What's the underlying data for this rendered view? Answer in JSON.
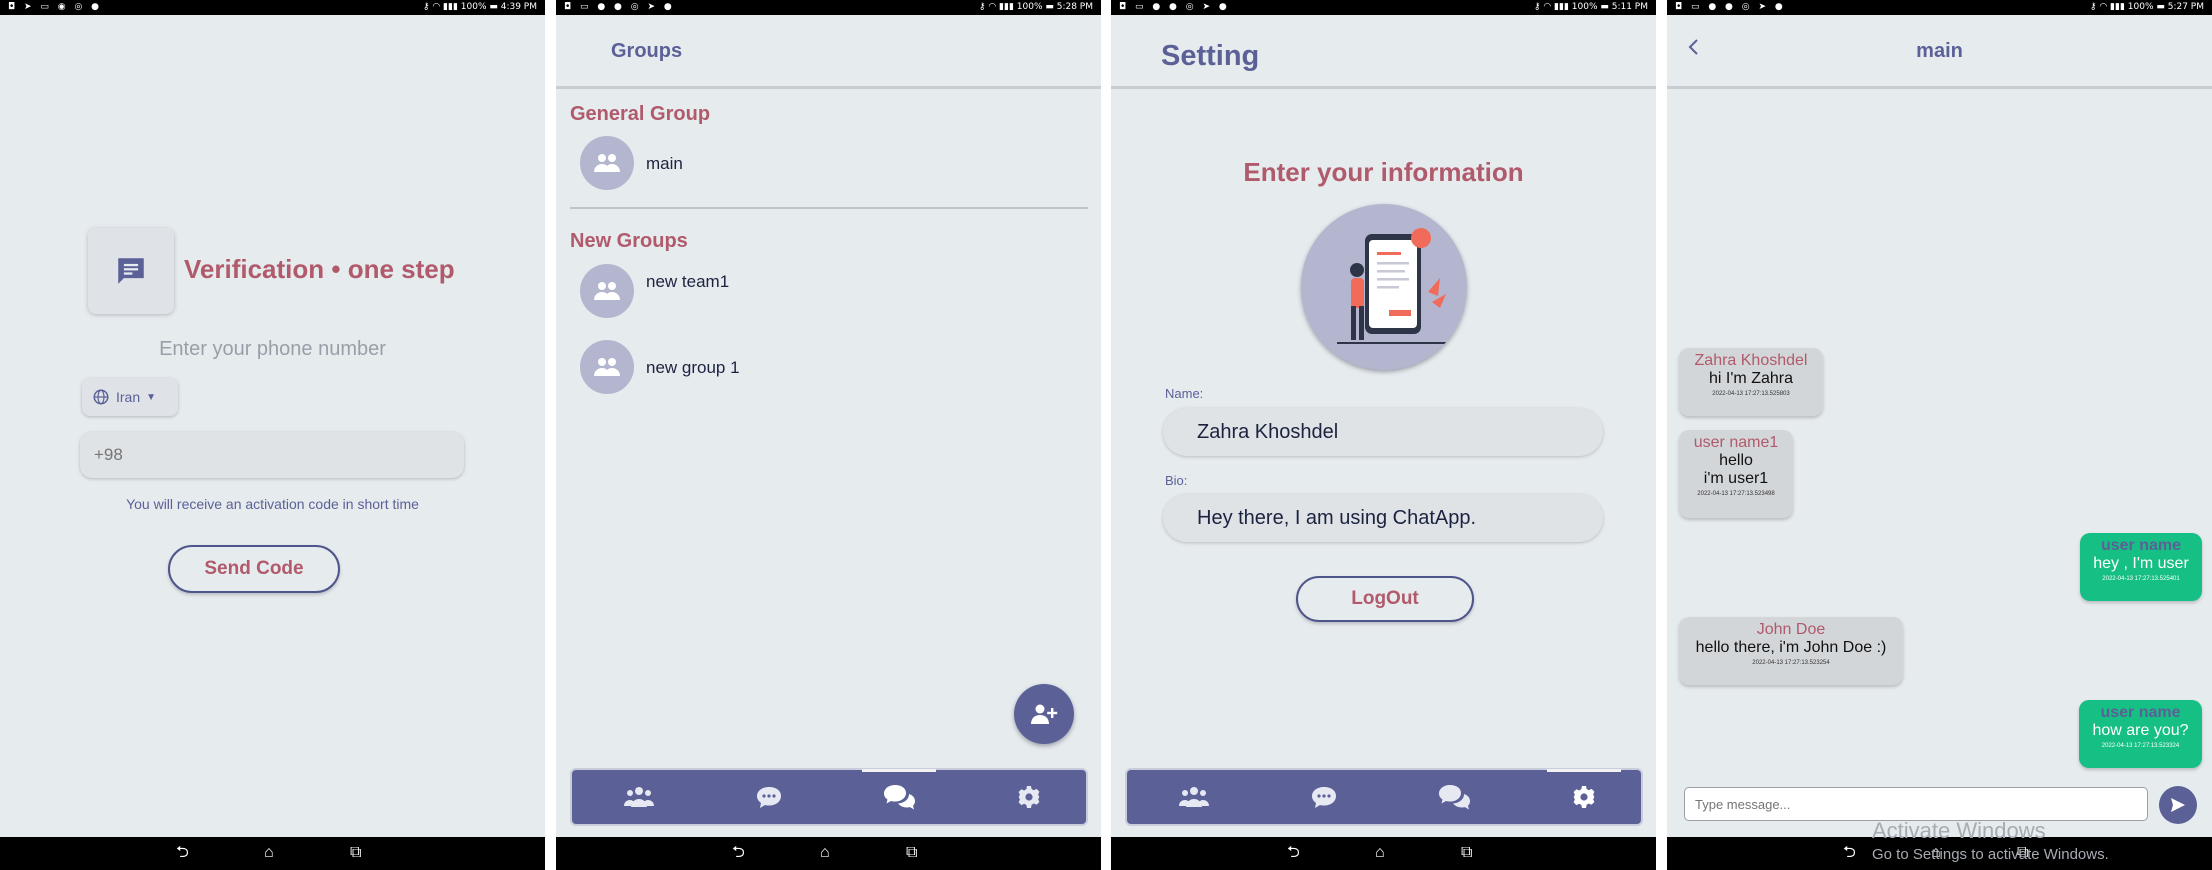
{
  "status": {
    "screen1": {
      "battery": "100%",
      "time": "4:39 PM"
    },
    "screen2": {
      "battery": "100%",
      "time": "5:28 PM"
    },
    "screen3": {
      "battery": "100%",
      "time": "5:11 PM"
    },
    "screen4": {
      "battery": "100%",
      "time": "5:27 PM"
    }
  },
  "verification": {
    "title": "Verification • one step",
    "subtitle": "Enter your phone number",
    "country": "Iran",
    "phone_placeholder": "+98",
    "hint": "You will receive an activation code in short time",
    "send_label": "Send Code"
  },
  "groups": {
    "header": "Groups",
    "general_heading": "General Group",
    "general_items": [
      {
        "label": "main"
      }
    ],
    "new_heading": "New Groups",
    "new_items": [
      {
        "label": "new team1"
      },
      {
        "label": "new group 1"
      }
    ]
  },
  "setting": {
    "header": "Setting",
    "title": "Enter your information",
    "name_label": "Name:",
    "name_value": "Zahra Khoshdel",
    "bio_label": "Bio:",
    "bio_value": "Hey there, I am using ChatApp.",
    "logout_label": "LogOut"
  },
  "chat": {
    "title": "main",
    "messages": [
      {
        "name": "Zahra Khoshdel",
        "lines": [
          "hi I'm Zahra"
        ],
        "time": "2022-04-13 17:27:13.525803",
        "mine": false
      },
      {
        "name": "user name1",
        "lines": [
          "hello",
          "i'm user1"
        ],
        "time": "2022-04-13 17:27:13.523498",
        "mine": false
      },
      {
        "name": "user name",
        "lines": [
          "hey , I'm user"
        ],
        "time": "2022-04-13 17:27:13.525401",
        "mine": true
      },
      {
        "name": "John Doe",
        "lines": [
          "hello there, i'm John Doe :)"
        ],
        "time": "2022-04-13 17:27:13.523254",
        "mine": false
      },
      {
        "name": "user name",
        "lines": [
          "how are you?"
        ],
        "time": "2022-04-13 17:27:13.523324",
        "mine": true
      }
    ],
    "input_placeholder": "Type message..."
  },
  "watermark": {
    "line1": "Activate Windows",
    "line2": "Go to Settings to activate Windows."
  },
  "icons": {
    "message": "message-icon",
    "globe": "globe-icon",
    "group": "group-icon",
    "add_user": "add-user-icon",
    "chat": "chat-bubble-icon",
    "chats": "chats-icon",
    "gear": "gear-icon",
    "send": "send-icon",
    "back": "back-arrow-icon"
  },
  "colors": {
    "primary": "#5b6197",
    "accent": "#b05a6c",
    "mine_bubble": "#16bf84",
    "background": "#e6ebee"
  }
}
